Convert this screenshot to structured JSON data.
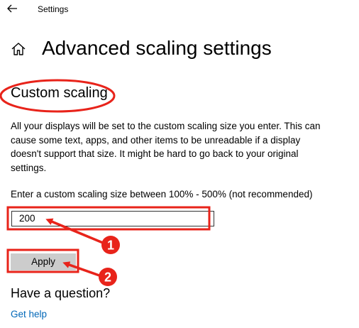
{
  "window": {
    "title": "Settings",
    "back_icon": "back-arrow-icon"
  },
  "header": {
    "title": "Advanced scaling settings",
    "home_icon": "home-icon"
  },
  "custom_scaling": {
    "heading": "Custom scaling",
    "description": "All your displays will be set to the custom scaling size you enter. This can cause some text, apps, and other items to be unreadable if a display doesn't support that size. It might be hard to go back to your original settings.",
    "input_label": "Enter a custom scaling size between 100% - 500% (not recommended)",
    "input_value": "200",
    "apply_label": "Apply"
  },
  "help": {
    "heading": "Have a question?",
    "link": "Get help"
  },
  "annotations": {
    "color": "#e8231a",
    "badges": [
      "1",
      "2"
    ]
  }
}
